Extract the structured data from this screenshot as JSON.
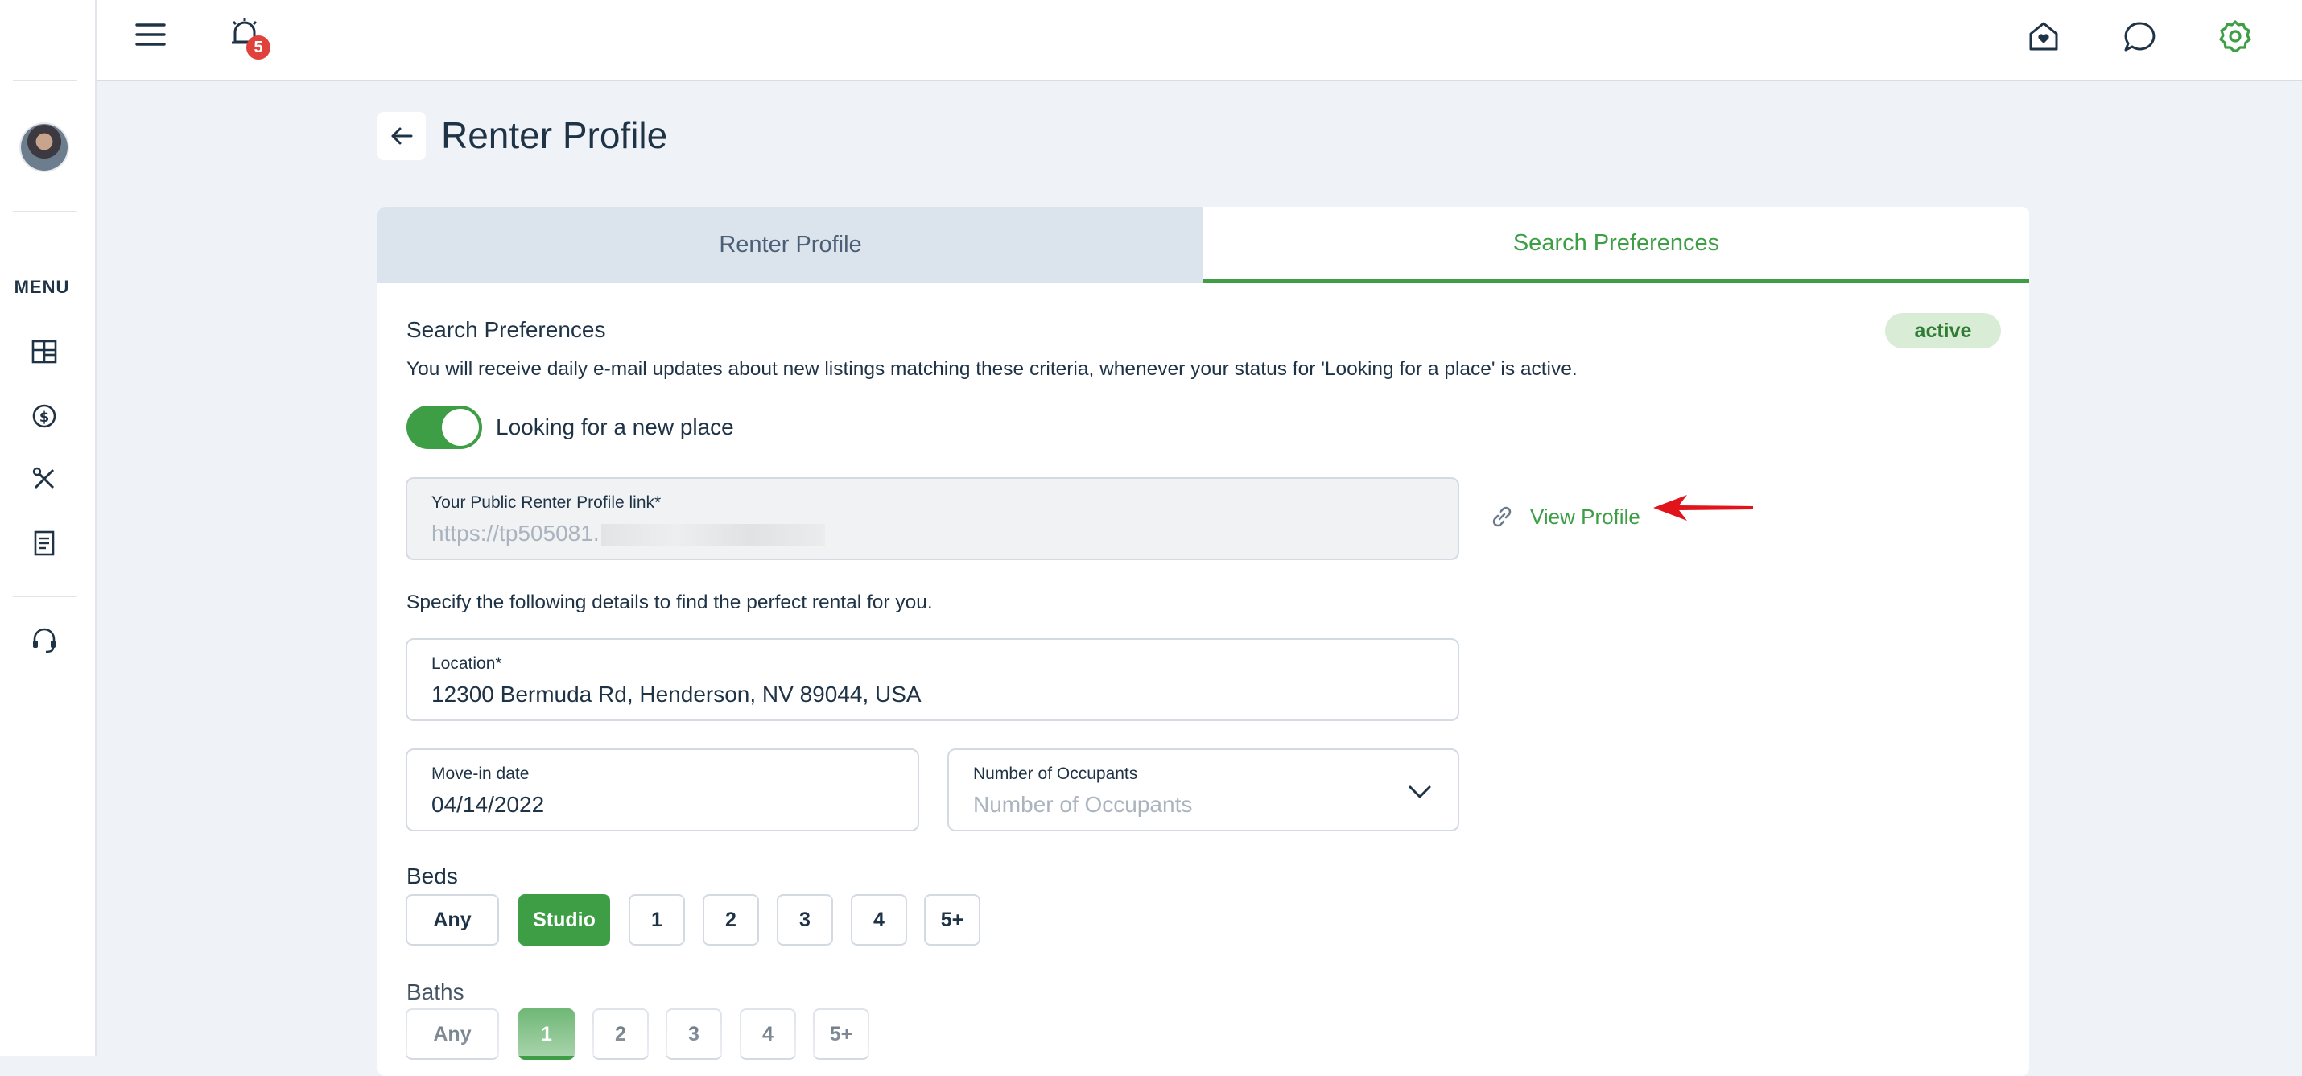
{
  "sidebar": {
    "menu_label": "MENU",
    "items": [
      {
        "icon": "dashboard-icon"
      },
      {
        "icon": "payments-icon"
      },
      {
        "icon": "maintenance-icon"
      },
      {
        "icon": "documents-icon"
      },
      {
        "icon": "support-icon"
      }
    ]
  },
  "topbar": {
    "notification_count": "5",
    "icons": [
      "hamburger-menu-icon",
      "alarm-bell-icon",
      "home-heart-icon",
      "chat-icon",
      "settings-icon"
    ]
  },
  "header": {
    "title": "Renter Profile"
  },
  "tabs": [
    {
      "label": "Renter Profile",
      "active": false
    },
    {
      "label": "Search Preferences",
      "active": true
    }
  ],
  "search_preferences": {
    "title": "Search Preferences",
    "status": "active",
    "description": "You will receive daily e-mail updates about new listings matching these criteria, whenever your status for 'Looking for a place' is active.",
    "toggle_label": "Looking for a new place",
    "toggle_on": true,
    "public_link": {
      "label": "Your Public Renter Profile link*",
      "value": "https://tp505081."
    },
    "view_profile_label": "View Profile",
    "specify_text": "Specify the following details to find the perfect rental for you.",
    "location": {
      "label": "Location*",
      "value": "12300 Bermuda Rd, Henderson, NV 89044, USA"
    },
    "move_in": {
      "label": "Move-in date",
      "value": "04/14/2022"
    },
    "occupants": {
      "label": "Number of Occupants",
      "placeholder": "Number of Occupants"
    },
    "beds": {
      "label": "Beds",
      "options": [
        "Any",
        "Studio",
        "1",
        "2",
        "3",
        "4",
        "5+"
      ],
      "selected": "Studio"
    },
    "baths": {
      "label": "Baths",
      "options": [
        "Any",
        "1",
        "2",
        "3",
        "4",
        "5+"
      ],
      "selected": "1"
    }
  },
  "colors": {
    "accent": "#3d9e45",
    "background": "#eff3f7",
    "text": "#1f3347",
    "badge": "#e0413b",
    "arrow": "#e0141a"
  }
}
